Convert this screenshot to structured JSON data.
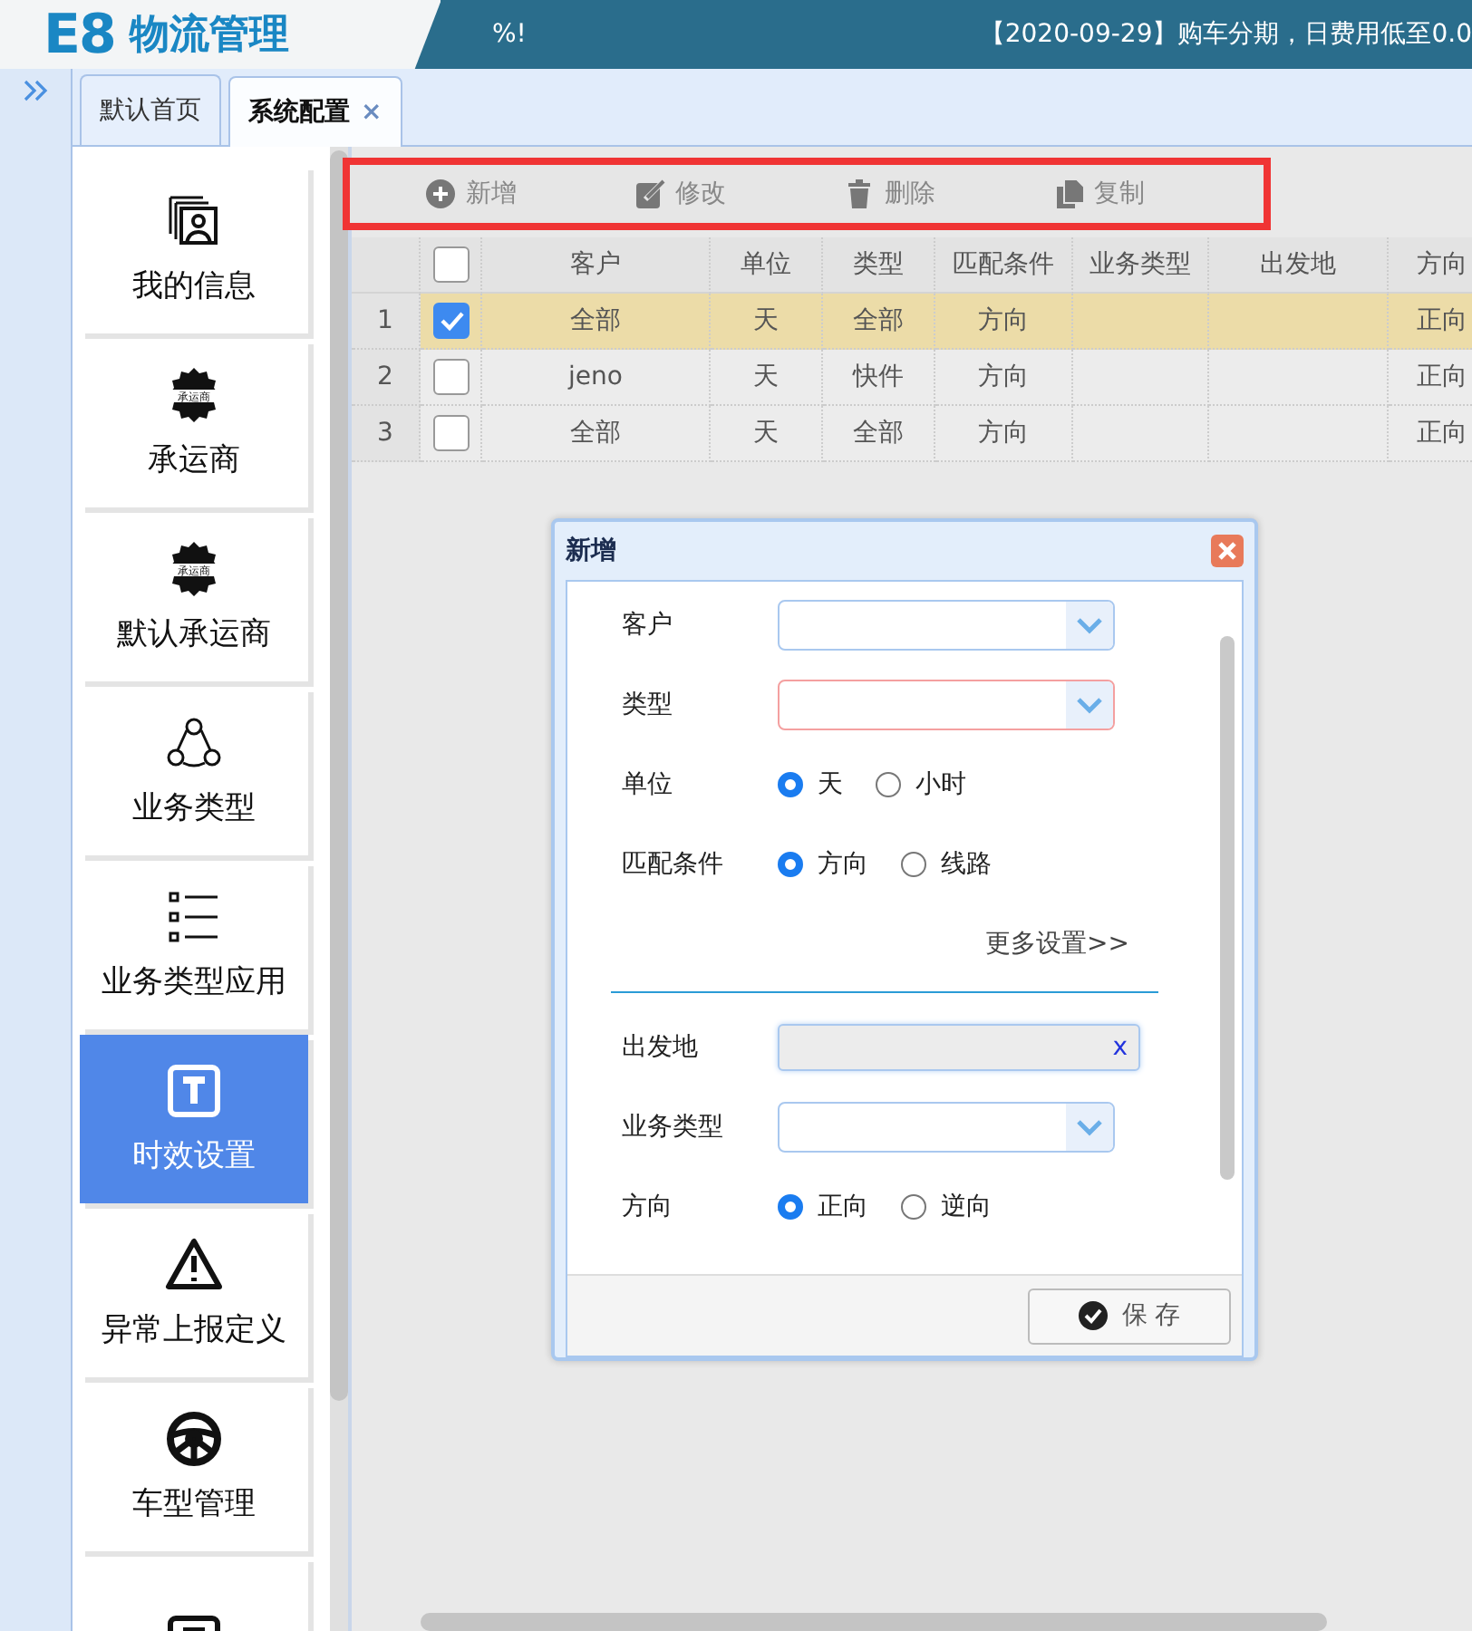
{
  "header": {
    "logo_mark": "E8",
    "logo_text": "物流管理",
    "notices": [
      "%!",
      "【2020-09-29】购车分期，日费用低至0.0"
    ]
  },
  "tabs": [
    {
      "label": "默认首页",
      "selected": false,
      "closable": false
    },
    {
      "label": "系统配置",
      "selected": true,
      "closable": true,
      "close": "×"
    }
  ],
  "sidebar": {
    "items": [
      {
        "label": "我的信息",
        "kind": "profile",
        "selected": false
      },
      {
        "label": "承运商",
        "kind": "seal",
        "badge_text": "承运商",
        "selected": false
      },
      {
        "label": "默认承运商",
        "kind": "seal",
        "badge_text": "承运商",
        "selected": false
      },
      {
        "label": "业务类型",
        "kind": "network",
        "selected": false
      },
      {
        "label": "业务类型应用",
        "kind": "list",
        "selected": false
      },
      {
        "label": "时效设置",
        "kind": "tbox",
        "selected": true
      },
      {
        "label": "异常上报定义",
        "kind": "warning",
        "selected": false
      },
      {
        "label": "车型管理",
        "kind": "wheel",
        "selected": false
      },
      {
        "kind": "tbox",
        "selected": false
      }
    ]
  },
  "toolbar": [
    {
      "label": "新增",
      "kind": "add"
    },
    {
      "label": "修改",
      "kind": "edit"
    },
    {
      "label": "删除",
      "kind": "delete"
    },
    {
      "label": "复制",
      "kind": "copy"
    }
  ],
  "table": {
    "columns": [
      "客户",
      "单位",
      "类型",
      "匹配条件",
      "业务类型",
      "出发地",
      "方向"
    ],
    "all_checked": false,
    "rows": [
      {
        "num": "1",
        "checked": true,
        "selected": true,
        "cells": [
          "全部",
          "天",
          "全部",
          "方向",
          "",
          "",
          "正向"
        ]
      },
      {
        "num": "2",
        "checked": false,
        "selected": false,
        "cells": [
          "jeno",
          "天",
          "快件",
          "方向",
          "",
          "",
          "正向"
        ]
      },
      {
        "num": "3",
        "checked": false,
        "selected": false,
        "cells": [
          "全部",
          "天",
          "全部",
          "方向",
          "",
          "",
          "正向"
        ]
      }
    ]
  },
  "dialog": {
    "title": "新增",
    "fields": [
      {
        "kind": "select",
        "label": "客户",
        "required": false
      },
      {
        "kind": "select",
        "label": "类型",
        "required": true
      },
      {
        "kind": "radio",
        "label": "单位",
        "options": [
          {
            "label": "天",
            "selected": true
          },
          {
            "label": "小时",
            "selected": false
          }
        ]
      },
      {
        "kind": "radio",
        "label": "匹配条件",
        "options": [
          {
            "label": "方向",
            "selected": true
          },
          {
            "label": "线路",
            "selected": false
          }
        ]
      },
      {
        "kind": "link",
        "label": "更多设置>>"
      },
      {
        "kind": "divider"
      },
      {
        "kind": "clearable",
        "label": "出发地",
        "clear": "x"
      },
      {
        "kind": "select",
        "label": "业务类型",
        "required": false
      },
      {
        "kind": "radio",
        "label": "方向",
        "options": [
          {
            "label": "正向",
            "selected": true
          },
          {
            "label": "逆向",
            "selected": false
          }
        ]
      }
    ],
    "save": "保 存"
  }
}
